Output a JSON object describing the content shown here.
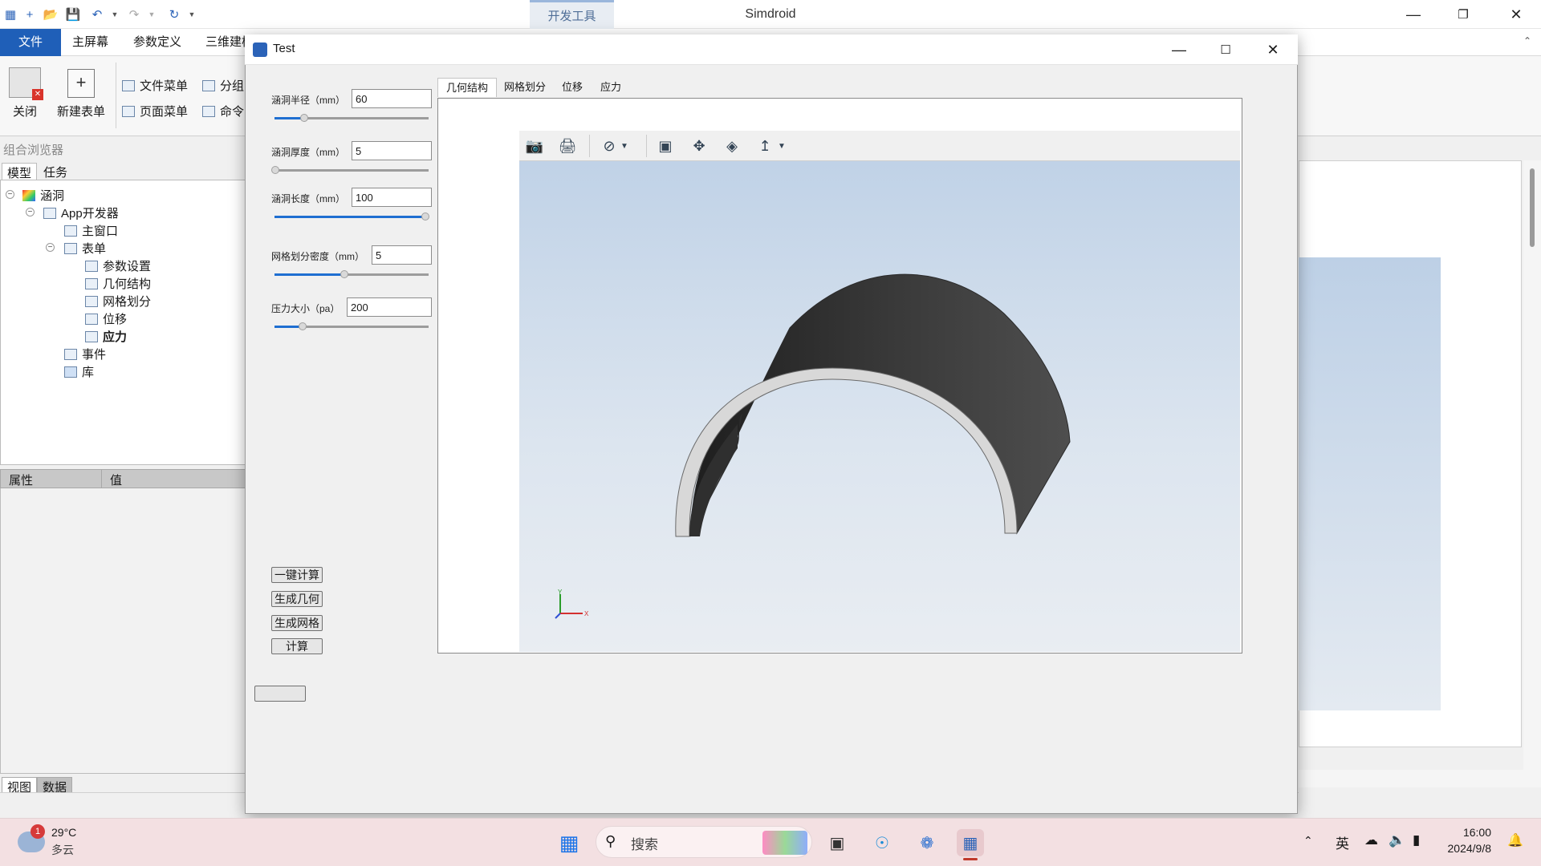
{
  "app": {
    "title": "Simdroid",
    "dev_tab": "开发工具",
    "menus": [
      "文件",
      "主屏幕",
      "参数定义",
      "三维建模"
    ],
    "ribbon": {
      "close": "关闭",
      "new_form": "新建表单",
      "file_menu": "文件菜单",
      "page_menu": "页面菜单",
      "group": "分组",
      "command": "命令"
    }
  },
  "browser": {
    "title": "组合浏览器",
    "tabs": [
      "模型",
      "任务"
    ],
    "tree": {
      "root": "涵洞",
      "app_dev": "App开发器",
      "main_window": "主窗口",
      "forms": "表单",
      "form_items": [
        "参数设置",
        "几何结构",
        "网格划分",
        "位移",
        "应力"
      ],
      "events": "事件",
      "library": "库"
    },
    "prop_headers": [
      "属性",
      "值"
    ],
    "bottom_tabs": [
      "视图",
      "数据"
    ]
  },
  "dialog": {
    "title": "Test",
    "params": [
      {
        "label": "涵洞半径（mm）",
        "value": "60",
        "slider": 0.18
      },
      {
        "label": "涵洞厚度（mm）",
        "value": "5",
        "slider": 0.0
      },
      {
        "label": "涵洞长度（mm）",
        "value": "100",
        "slider": 1.0
      },
      {
        "label": "网格划分密度（mm）",
        "value": "5",
        "slider": 0.45
      },
      {
        "label": "压力大小（pa）",
        "value": "200",
        "slider": 0.18
      }
    ],
    "buttons": [
      "一键计算",
      "生成几何",
      "生成网格",
      "计算"
    ],
    "tabs": [
      "几何结构",
      "网格划分",
      "位移",
      "应力"
    ],
    "axis": {
      "x": "X",
      "y": "Y"
    }
  },
  "taskbar": {
    "weather_temp": "29°C",
    "weather_desc": "多云",
    "weather_badge": "1",
    "search_placeholder": "搜索",
    "ime": "英",
    "time": "16:00",
    "date": "2024/9/8"
  },
  "colors": {
    "accent": "#1f5fb8",
    "viewport_top": "#bdd0e6",
    "model_dark": "#3a3a3a",
    "model_light": "#d9d9d9"
  }
}
